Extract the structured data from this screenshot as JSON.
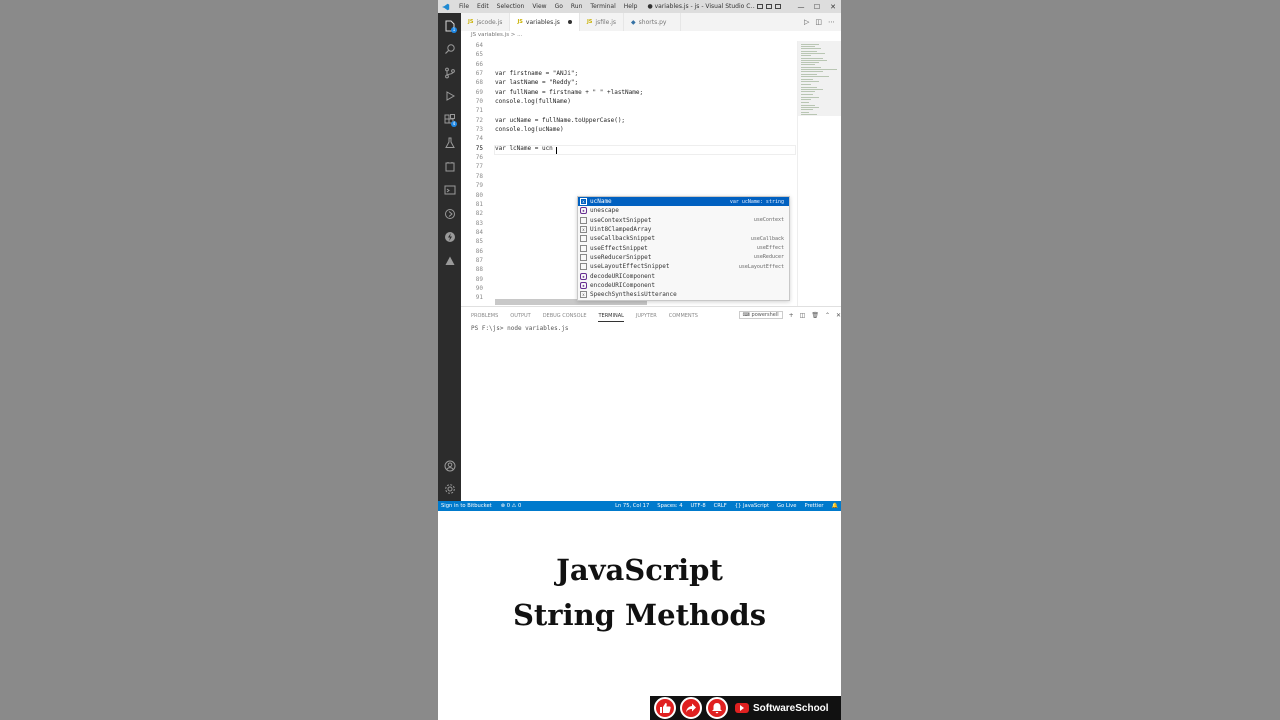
{
  "window": {
    "title": "● variables.js - js - Visual Studio C...",
    "menu": [
      "File",
      "Edit",
      "Selection",
      "View",
      "Go",
      "Run",
      "Terminal",
      "Help"
    ]
  },
  "tabs": [
    {
      "label": "jscode.js",
      "kind": "js",
      "active": false
    },
    {
      "label": "variables.js",
      "kind": "js",
      "active": true,
      "dirty": true
    },
    {
      "label": "jsfile.js",
      "kind": "js",
      "active": false
    },
    {
      "label": "shorts.py",
      "kind": "py",
      "active": false
    }
  ],
  "breadcrumb": "JS variables.js > ...",
  "editor": {
    "line_numbers": [
      "64",
      "65",
      "66",
      "67",
      "68",
      "69",
      "70",
      "71",
      "72",
      "73",
      "74",
      "75",
      "76",
      "77",
      "78",
      "79",
      "80",
      "81",
      "82",
      "83",
      "84",
      "85",
      "86",
      "87",
      "88",
      "89",
      "90",
      "91"
    ],
    "current_line": "75",
    "lines": [
      "",
      "",
      "",
      "var firstname = \"ANJi\";",
      "var lastName = \"Reddy\";",
      "var fullName = firstname + \" \" +lastName;",
      "console.log(fullName)",
      "",
      "var ucName = fullName.toUpperCase();",
      "console.log(ucName)",
      "",
      "var lcName = ucn",
      "",
      "",
      "",
      "",
      "",
      "",
      "",
      "",
      "",
      "",
      "",
      "",
      "",
      "",
      "",
      ""
    ]
  },
  "suggestions": [
    {
      "label": "ucName",
      "detail": "var ucName: string",
      "icon": "var-icon",
      "selected": true
    },
    {
      "label": "unescape",
      "detail": "",
      "icon": "function-icon"
    },
    {
      "label": "useContextSnippet",
      "detail": "useContext",
      "icon": "snippet-icon"
    },
    {
      "label": "Uint8ClampedArray",
      "detail": "",
      "icon": "var-icon"
    },
    {
      "label": "useCallbackSnippet",
      "detail": "useCallback",
      "icon": "snippet-icon"
    },
    {
      "label": "useEffectSnippet",
      "detail": "useEffect",
      "icon": "snippet-icon"
    },
    {
      "label": "useReducerSnippet",
      "detail": "useReducer",
      "icon": "snippet-icon"
    },
    {
      "label": "useLayoutEffectSnippet",
      "detail": "useLayoutEffect",
      "icon": "snippet-icon"
    },
    {
      "label": "decodeURIComponent",
      "detail": "",
      "icon": "function-icon"
    },
    {
      "label": "encodeURIComponent",
      "detail": "",
      "icon": "function-icon"
    },
    {
      "label": "SpeechSynthesisUtterance",
      "detail": "",
      "icon": "var-icon"
    }
  ],
  "panel": {
    "tabs": [
      "PROBLEMS",
      "OUTPUT",
      "DEBUG CONSOLE",
      "TERMINAL",
      "JUPYTER",
      "COMMENTS"
    ],
    "active_tab": "TERMINAL",
    "shell": "powershell",
    "prompt": "PS F:\\js> node variables.js"
  },
  "statusbar": {
    "left": [
      "Sign in to Bitbucket",
      "⊗ 0 ⚠ 0"
    ],
    "right": [
      "Ln 75, Col 17",
      "Spaces: 4",
      "UTF-8",
      "CRLF",
      "{} JavaScript",
      "Go Live",
      "Prettier"
    ]
  },
  "caption": {
    "line1": "JavaScript",
    "line2": "String Methods"
  },
  "brand": {
    "name": "SoftwareSchool"
  },
  "colors": {
    "status_bar": "#007acc",
    "selection": "#0060c0",
    "brand_red": "#e02020"
  }
}
